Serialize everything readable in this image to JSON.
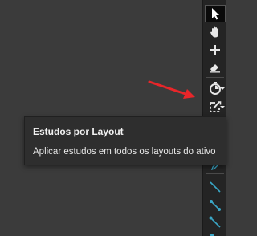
{
  "tooltip": {
    "title": "Estudos por Layout",
    "description": "Aplicar estudos em todos os layouts do ativo"
  },
  "toolbar": {
    "tools": [
      {
        "id": "cursor",
        "icon": "cursor-arrow-icon",
        "active": true
      },
      {
        "id": "pan",
        "icon": "hand-icon"
      },
      {
        "id": "crosshair",
        "icon": "plus-crosshair-icon"
      },
      {
        "id": "eraser",
        "icon": "eraser-icon"
      },
      {
        "id": "timer",
        "icon": "stopwatch-icon",
        "has_dropdown": true
      },
      {
        "id": "studies-per-layout",
        "icon": "studies-layout-icon",
        "has_dropdown": true
      },
      {
        "id": "trend-line",
        "icon": "line-diagonal-icon"
      },
      {
        "id": "ray",
        "icon": "ray-line-icon"
      },
      {
        "id": "arrow-line",
        "icon": "arrow-line-icon"
      },
      {
        "id": "extended-line",
        "icon": "extended-line-icon"
      }
    ]
  },
  "colors": {
    "annotation_arrow": "#e8262a",
    "line_tool_accent": "#3aa7c7",
    "toolbar_bg": "#242424",
    "canvas_bg": "#3b3b3b"
  }
}
